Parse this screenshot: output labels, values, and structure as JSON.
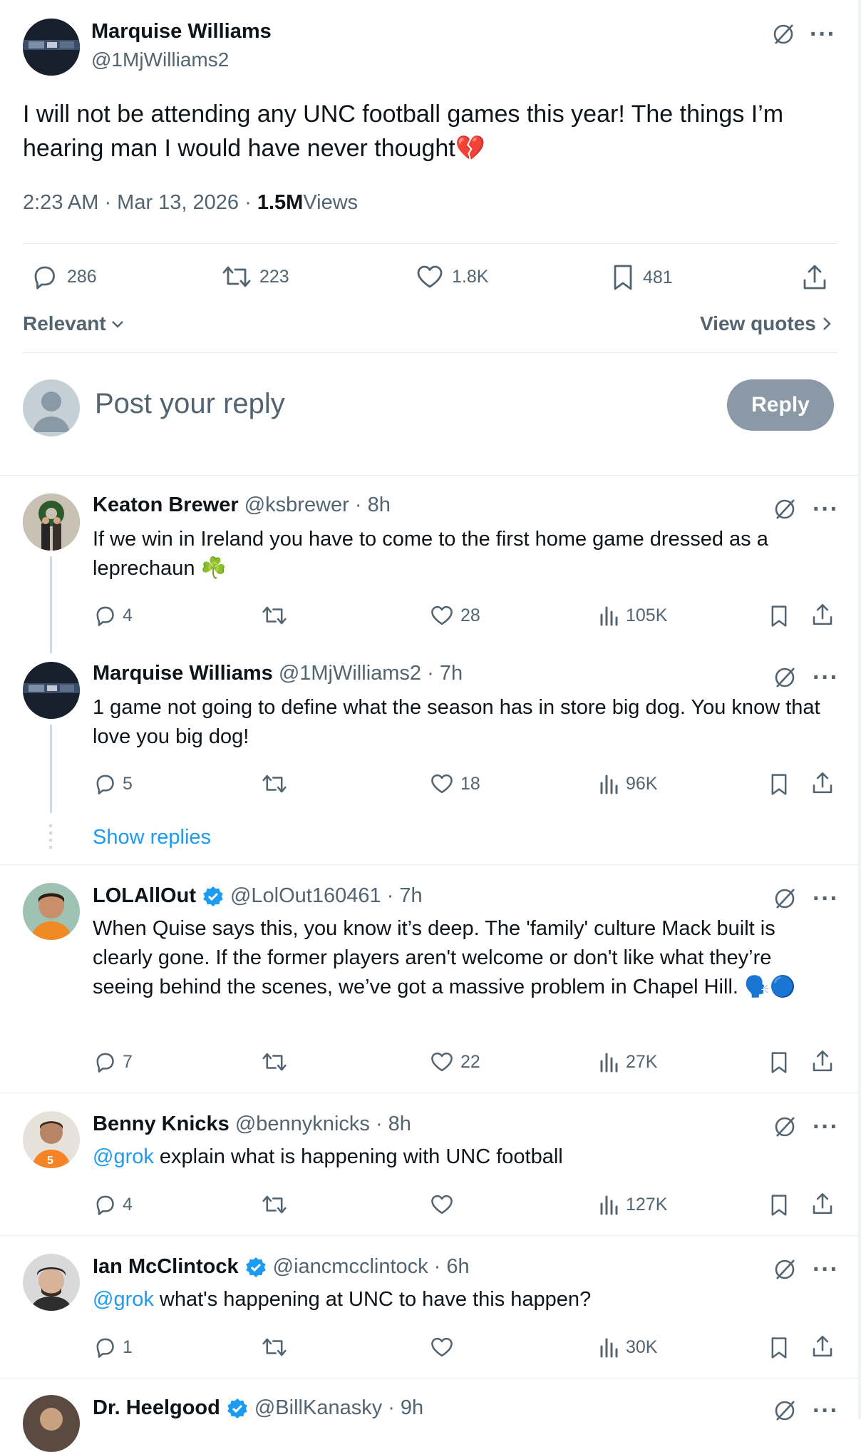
{
  "post": {
    "author_name": "Marquise Williams",
    "author_handle": "@1MjWilliams2",
    "text": "I will not be attending any UNC football games this year! The things I’m hearing man I would have never thought💔",
    "timestamp": "2:23 AM · Mar 13, 2026 · ",
    "views_count": "1.5M",
    "views_label": "Views",
    "stats": {
      "replies": "286",
      "reposts": "223",
      "likes": "1.8K",
      "bookmarks": "481"
    },
    "sort_label": "Relevant",
    "view_quotes_label": "View quotes"
  },
  "composer": {
    "placeholder": "Post your reply",
    "reply_button": "Reply"
  },
  "replies": [
    {
      "name": "Keaton Brewer",
      "handle": "@ksbrewer",
      "time": "· 8h",
      "verified": false,
      "text": "If we win in Ireland you have to come to the first home game dressed as a leprechaun ☘️",
      "replies": "4",
      "reposts": "",
      "likes": "28",
      "views": "105K"
    },
    {
      "name": "Marquise Williams",
      "handle": "@1MjWilliams2",
      "time": "· 7h",
      "verified": false,
      "text": "1 game not going to define what the season has in store big dog. You know that love you big dog!",
      "replies": "5",
      "reposts": "",
      "likes": "18",
      "views": "96K"
    },
    {
      "name": "LOLAllOut",
      "handle": "@LolOut160461",
      "time": "· 7h",
      "verified": true,
      "text": "When Quise says this, you know it’s deep. The 'family' culture Mack built is clearly gone. If the former players aren't welcome or don't like what they’re seeing behind the scenes, we’ve got a massive problem in Chapel Hill. 🗣️🔵",
      "replies": "7",
      "reposts": "",
      "likes": "22",
      "views": "27K"
    },
    {
      "name": "Benny Knicks",
      "handle": "@bennyknicks",
      "time": "· 8h",
      "verified": false,
      "mention": "@grok",
      "text": " explain what is happening with UNC football",
      "replies": "4",
      "reposts": "",
      "likes": "",
      "views": "127K"
    },
    {
      "name": "Ian McClintock",
      "handle": "@iancmcclintock",
      "time": "· 6h",
      "verified": true,
      "mention": "@grok",
      "text": " what's happening at UNC to have this happen?",
      "replies": "1",
      "reposts": "",
      "likes": "",
      "views": "30K"
    },
    {
      "name": "Dr. Heelgood",
      "handle": "@BillKanasky",
      "time": "· 9h",
      "verified": true
    }
  ],
  "show_replies_label": "Show replies",
  "more_label": "···",
  "colors": {
    "link": "#1d9bf0",
    "verified": "#1d9bf0",
    "muted": "#536471",
    "reply_button_bg": "#8b98a5"
  }
}
